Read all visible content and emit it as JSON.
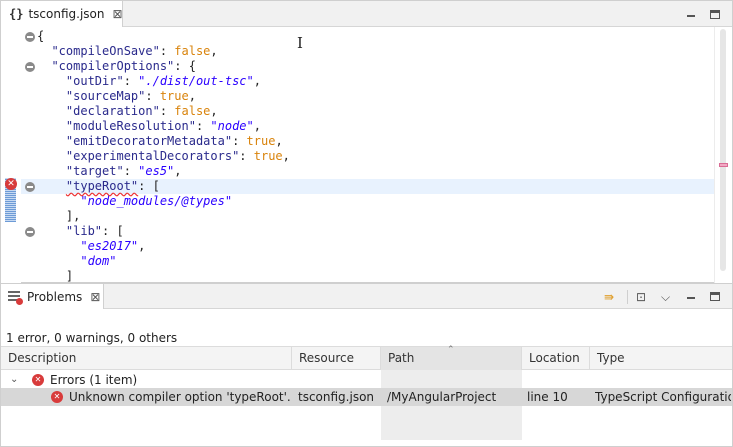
{
  "editor": {
    "tab_icon": "{}",
    "tab_label": "tsconfig.json",
    "close_glyph": "⊠",
    "lines": [
      {
        "parts": [
          [
            "p",
            "{"
          ]
        ],
        "fold": true
      },
      {
        "parts": [
          [
            "k",
            "  \"compileOnSave\""
          ],
          [
            "p",
            ": "
          ],
          [
            "kw",
            "false"
          ],
          [
            "p",
            ","
          ]
        ]
      },
      {
        "parts": [
          [
            "k",
            "  \"compilerOptions\""
          ],
          [
            "p",
            ": {"
          ]
        ],
        "fold": true
      },
      {
        "parts": [
          [
            "k",
            "    \"outDir\""
          ],
          [
            "p",
            ": "
          ],
          [
            "s",
            "\"./dist/out-tsc\""
          ],
          [
            "p",
            ","
          ]
        ]
      },
      {
        "parts": [
          [
            "k",
            "    \"sourceMap\""
          ],
          [
            "p",
            ": "
          ],
          [
            "kw",
            "true"
          ],
          [
            "p",
            ","
          ]
        ]
      },
      {
        "parts": [
          [
            "k",
            "    \"declaration\""
          ],
          [
            "p",
            ": "
          ],
          [
            "kw",
            "false"
          ],
          [
            "p",
            ","
          ]
        ]
      },
      {
        "parts": [
          [
            "k",
            "    \"moduleResolution\""
          ],
          [
            "p",
            ": "
          ],
          [
            "s",
            "\"node\""
          ],
          [
            "p",
            ","
          ]
        ]
      },
      {
        "parts": [
          [
            "k",
            "    \"emitDecoratorMetadata\""
          ],
          [
            "p",
            ": "
          ],
          [
            "kw",
            "true"
          ],
          [
            "p",
            ","
          ]
        ]
      },
      {
        "parts": [
          [
            "k",
            "    \"experimentalDecorators\""
          ],
          [
            "p",
            ": "
          ],
          [
            "kw",
            "true"
          ],
          [
            "p",
            ","
          ]
        ]
      },
      {
        "parts": [
          [
            "k",
            "    \"target\""
          ],
          [
            "p",
            ": "
          ],
          [
            "s",
            "\"es5\""
          ],
          [
            "p",
            ","
          ]
        ]
      },
      {
        "parts": [
          [
            "p",
            "    "
          ],
          [
            "kerr",
            "\"typeRoot\""
          ],
          [
            "p",
            ": ["
          ]
        ],
        "fold": true,
        "current": true
      },
      {
        "parts": [
          [
            "s",
            "      \"node_modules/@types\""
          ]
        ]
      },
      {
        "parts": [
          [
            "p",
            "    ],"
          ]
        ]
      },
      {
        "parts": [
          [
            "k",
            "    \"lib\""
          ],
          [
            "p",
            ": ["
          ]
        ],
        "fold": true
      },
      {
        "parts": [
          [
            "s",
            "      \"es2017\""
          ],
          [
            "p",
            ","
          ]
        ]
      },
      {
        "parts": [
          [
            "s",
            "      \"dom\""
          ]
        ]
      },
      {
        "parts": [
          [
            "p",
            "    ]"
          ]
        ]
      }
    ]
  },
  "problems": {
    "tab_label": "Problems",
    "close_glyph": "⊠",
    "summary": "1 error, 0 warnings, 0 others",
    "columns": [
      "Description",
      "Resource",
      "Path",
      "Location",
      "Type"
    ],
    "group_label": "Errors (1 item)",
    "rows": [
      {
        "description": "Unknown compiler option 'typeRoot'.",
        "resource": "tsconfig.json",
        "path": "/MyAngularProject",
        "location": "line 10",
        "type": "TypeScript Configuration"
      }
    ]
  },
  "colors": {
    "error": "#d83b3b",
    "json_key": "#2a2a8c",
    "json_string": "#2a00ff",
    "json_keyword": "#d9830b",
    "current_line": "#e8f2fe"
  }
}
